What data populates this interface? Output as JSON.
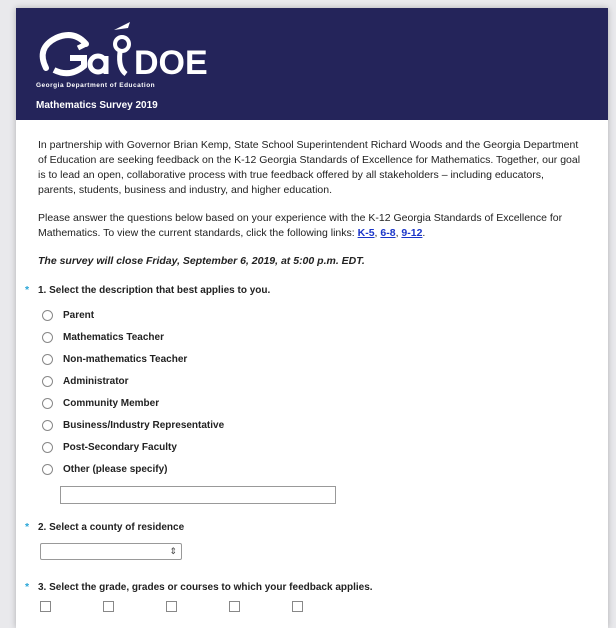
{
  "header": {
    "logo_text": "GaDOE",
    "tagline": "Georgia Department of Education",
    "survey_title": "Mathematics Survey 2019",
    "bg_color": "#24245a"
  },
  "intro": {
    "paragraph1": "In partnership with Governor Brian Kemp, State School Superintendent Richard Woods and the Georgia Department of Education are seeking feedback on the K-12 Georgia Standards of Excellence for Mathematics. Together, our goal is to lead an open, collaborative process with true feedback offered by all stakeholders – including educators, parents, students, business and industry, and higher education.",
    "paragraph2_prefix": "Please answer the questions below based on your experience with the K-12 Georgia Standards of Excellence for Mathematics. To view the current standards, click the following links: ",
    "links": [
      "K-5",
      "6-8",
      "9-12"
    ],
    "link_sep": ", ",
    "link_end": ".",
    "closing": "The survey will close Friday, September 6, 2019, at 5:00 p.m. EDT."
  },
  "q1": {
    "required_mark": "*",
    "title": "1. Select the description that best applies to you.",
    "options": [
      "Parent",
      "Mathematics Teacher",
      "Non-mathematics Teacher",
      "Administrator",
      "Community Member",
      "Business/Industry Representative",
      "Post-Secondary Faculty",
      "Other (please specify)"
    ],
    "other_value": ""
  },
  "q2": {
    "required_mark": "*",
    "title": "2. Select a county of residence",
    "selected": "",
    "arrow_icon": "updown-arrow-icon"
  },
  "q3": {
    "required_mark": "*",
    "title": "3. Select the grade, grades or courses to which your feedback applies."
  }
}
